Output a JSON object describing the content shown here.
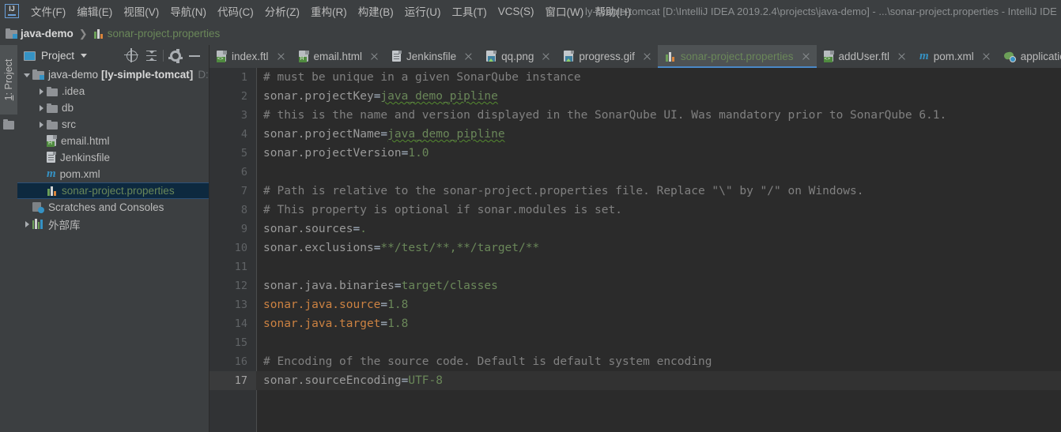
{
  "window": {
    "title": "ly-simple-tomcat [D:\\IntelliJ IDEA 2019.2.4\\projects\\java-demo] - ...\\sonar-project.properties - IntelliJ IDE",
    "logo": "intellij-idea-logo"
  },
  "menubar": {
    "items": [
      {
        "label": "文件(F)"
      },
      {
        "label": "编辑(E)"
      },
      {
        "label": "视图(V)"
      },
      {
        "label": "导航(N)"
      },
      {
        "label": "代码(C)"
      },
      {
        "label": "分析(Z)"
      },
      {
        "label": "重构(R)"
      },
      {
        "label": "构建(B)"
      },
      {
        "label": "运行(U)"
      },
      {
        "label": "工具(T)"
      },
      {
        "label": "VCS(S)"
      },
      {
        "label": "窗口(W)"
      },
      {
        "label": "帮助(H)"
      }
    ]
  },
  "breadcrumb": {
    "project": "java-demo",
    "separator": "❯",
    "file": "sonar-project.properties"
  },
  "toolstrip": {
    "project_tab_index": "1",
    "project_tab_label": ": Project"
  },
  "project_panel": {
    "title": "Project",
    "tools": [
      {
        "name": "locate-icon",
        "tooltip": "Select Opened File"
      },
      {
        "name": "collapse-all-icon",
        "tooltip": "Collapse All"
      },
      {
        "name": "gear-icon",
        "tooltip": "Settings"
      },
      {
        "name": "minimize-icon",
        "tooltip": "Hide"
      }
    ],
    "tree": [
      {
        "label": "java-demo",
        "module": "[ly-simple-tomcat]",
        "path": "D:\\",
        "icon": "module-folder-icon",
        "state": "expanded",
        "depth": 0,
        "selected": false
      },
      {
        "label": ".idea",
        "icon": "folder-icon",
        "state": "collapsed",
        "depth": 1,
        "selected": false
      },
      {
        "label": "db",
        "icon": "folder-icon",
        "state": "collapsed",
        "depth": 1,
        "selected": false
      },
      {
        "label": "src",
        "icon": "folder-icon",
        "state": "collapsed",
        "depth": 1,
        "selected": false
      },
      {
        "label": "email.html",
        "icon": "html-file-icon",
        "state": "leaf",
        "depth": 1,
        "selected": false
      },
      {
        "label": "Jenkinsfile",
        "icon": "text-file-icon",
        "state": "leaf",
        "depth": 1,
        "selected": false
      },
      {
        "label": "pom.xml",
        "icon": "maven-icon",
        "state": "leaf",
        "depth": 1,
        "selected": false
      },
      {
        "label": "sonar-project.properties",
        "icon": "properties-icon",
        "state": "leaf",
        "depth": 1,
        "selected": true
      },
      {
        "label": "Scratches and Consoles",
        "icon": "scratches-icon",
        "state": "leaf",
        "depth": 0,
        "selected": false
      },
      {
        "label": "外部库",
        "icon": "library-icon",
        "state": "collapsed",
        "depth": 0,
        "selected": false
      }
    ]
  },
  "editor_tabs": [
    {
      "label": "index.ftl",
      "icon": "ftl-file-icon",
      "active": false,
      "closable": true
    },
    {
      "label": "email.html",
      "icon": "html-file-icon",
      "active": false,
      "closable": true
    },
    {
      "label": "Jenkinsfile",
      "icon": "text-file-icon",
      "active": false,
      "closable": true
    },
    {
      "label": "qq.png",
      "icon": "image-file-icon",
      "active": false,
      "closable": true
    },
    {
      "label": "progress.gif",
      "icon": "image-file-icon",
      "active": false,
      "closable": true
    },
    {
      "label": "sonar-project.properties",
      "icon": "properties-icon",
      "active": true,
      "closable": true
    },
    {
      "label": "addUser.ftl",
      "icon": "ftl-file-icon",
      "active": false,
      "closable": true
    },
    {
      "label": "pom.xml",
      "icon": "maven-icon",
      "active": false,
      "closable": true
    },
    {
      "label": "application.yml",
      "icon": "yaml-file-icon",
      "active": false,
      "closable": true
    }
  ],
  "editor": {
    "current_line": 17,
    "lines": [
      {
        "n": "1",
        "tokens": [
          {
            "t": "# must be unique in a given SonarQube instance",
            "c": "comment",
            "spell": false
          }
        ]
      },
      {
        "n": "2",
        "tokens": [
          {
            "t": "sonar.projectKey",
            "c": "key"
          },
          {
            "t": "=",
            "c": "eq"
          },
          {
            "t": "java_demo_pipline",
            "c": "val",
            "spell": true
          }
        ]
      },
      {
        "n": "3",
        "tokens": [
          {
            "t": "# this is the name and version displayed in the SonarQube UI. Was mandatory prior to SonarQube 6.1.",
            "c": "comment"
          }
        ]
      },
      {
        "n": "4",
        "tokens": [
          {
            "t": "sonar.projectName",
            "c": "key"
          },
          {
            "t": "=",
            "c": "eq"
          },
          {
            "t": "java_demo_pipline",
            "c": "val",
            "spell": true
          }
        ]
      },
      {
        "n": "5",
        "tokens": [
          {
            "t": "sonar.projectVersion",
            "c": "key"
          },
          {
            "t": "=",
            "c": "eq"
          },
          {
            "t": "1.0",
            "c": "num"
          }
        ]
      },
      {
        "n": "6",
        "tokens": []
      },
      {
        "n": "7",
        "tokens": [
          {
            "t": "# Path is relative to the sonar-project.properties file. Replace \"\\\" by \"/\" on Windows.",
            "c": "comment"
          }
        ]
      },
      {
        "n": "8",
        "tokens": [
          {
            "t": "# This property is optional if sonar.modules is set.",
            "c": "comment"
          }
        ]
      },
      {
        "n": "9",
        "tokens": [
          {
            "t": "sonar.sources",
            "c": "key"
          },
          {
            "t": "=",
            "c": "eq"
          },
          {
            "t": ".",
            "c": "val"
          }
        ]
      },
      {
        "n": "10",
        "tokens": [
          {
            "t": "sonar.exclusions",
            "c": "key"
          },
          {
            "t": "=",
            "c": "eq"
          },
          {
            "t": "**/test/**,**/target/**",
            "c": "val"
          }
        ]
      },
      {
        "n": "11",
        "tokens": []
      },
      {
        "n": "12",
        "tokens": [
          {
            "t": "sonar.java.binaries",
            "c": "key"
          },
          {
            "t": "=",
            "c": "eq"
          },
          {
            "t": "target/classes",
            "c": "val"
          }
        ]
      },
      {
        "n": "13",
        "tokens": [
          {
            "t": "sonar.java.source",
            "c": "key-hl"
          },
          {
            "t": "=",
            "c": "eq"
          },
          {
            "t": "1.8",
            "c": "num"
          }
        ]
      },
      {
        "n": "14",
        "tokens": [
          {
            "t": "sonar.java.target",
            "c": "key-hl"
          },
          {
            "t": "=",
            "c": "eq"
          },
          {
            "t": "1.8",
            "c": "num"
          }
        ]
      },
      {
        "n": "15",
        "tokens": []
      },
      {
        "n": "16",
        "tokens": [
          {
            "t": "# Encoding of the source code. Default is default system encoding",
            "c": "comment"
          }
        ]
      },
      {
        "n": "17",
        "tokens": [
          {
            "t": "sonar.sourceEncoding",
            "c": "key"
          },
          {
            "t": "=",
            "c": "eq"
          },
          {
            "t": "UTF-8",
            "c": "val"
          }
        ]
      }
    ]
  },
  "colors": {
    "accent_blue": "#4a88c7",
    "selection_bg": "#0d293f",
    "editor_bg": "#2b2b2b",
    "gutter_bg": "#313335",
    "chrome_bg": "#3c3f41",
    "string_green": "#6a8759",
    "key_orange": "#cc8242",
    "comment_gray": "#808080"
  }
}
